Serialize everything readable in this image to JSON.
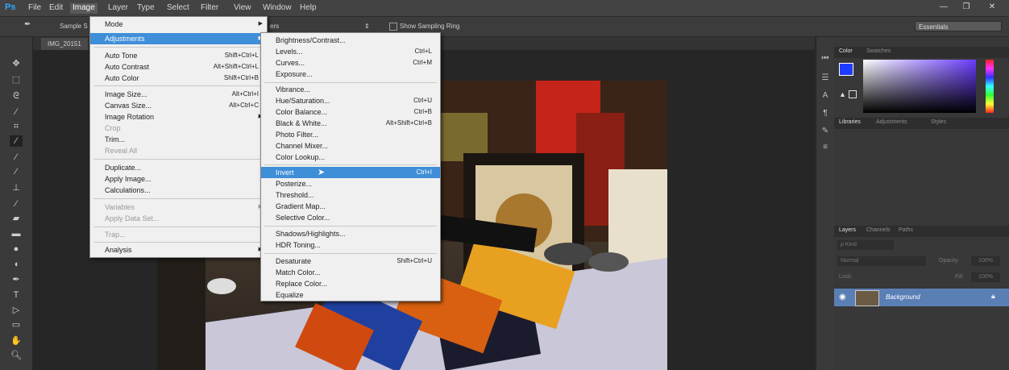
{
  "app": {
    "logo": "Ps"
  },
  "menubar": {
    "items": [
      "File",
      "Edit",
      "Image",
      "Layer",
      "Type",
      "Select",
      "Filter",
      "View",
      "Window",
      "Help"
    ]
  },
  "window_controls": {
    "minimize": "—",
    "maximize": "❐",
    "close": "✕"
  },
  "options_bar": {
    "sample_label": "Sample S",
    "layers_label": "ers",
    "show_ring_label": "Show Sampling Ring",
    "workspace": "Essentials"
  },
  "document": {
    "tab_title": "IMG_20151"
  },
  "image_menu": {
    "items": [
      {
        "label": "Mode",
        "shortcut": "",
        "submenu": true,
        "disabled": false
      },
      {
        "label": "Adjustments",
        "shortcut": "",
        "submenu": true,
        "disabled": false
      },
      {
        "label": "Auto Tone",
        "shortcut": "Shift+Ctrl+L",
        "submenu": false,
        "disabled": false
      },
      {
        "label": "Auto Contrast",
        "shortcut": "Alt+Shift+Ctrl+L",
        "submenu": false,
        "disabled": false
      },
      {
        "label": "Auto Color",
        "shortcut": "Shift+Ctrl+B",
        "submenu": false,
        "disabled": false
      },
      {
        "label": "Image Size...",
        "shortcut": "Alt+Ctrl+I",
        "submenu": false,
        "disabled": false
      },
      {
        "label": "Canvas Size...",
        "shortcut": "Alt+Ctrl+C",
        "submenu": false,
        "disabled": false
      },
      {
        "label": "Image Rotation",
        "shortcut": "",
        "submenu": true,
        "disabled": false
      },
      {
        "label": "Crop",
        "shortcut": "",
        "submenu": false,
        "disabled": true
      },
      {
        "label": "Trim...",
        "shortcut": "",
        "submenu": false,
        "disabled": false
      },
      {
        "label": "Reveal All",
        "shortcut": "",
        "submenu": false,
        "disabled": true
      },
      {
        "label": "Duplicate...",
        "shortcut": "",
        "submenu": false,
        "disabled": false
      },
      {
        "label": "Apply Image...",
        "shortcut": "",
        "submenu": false,
        "disabled": false
      },
      {
        "label": "Calculations...",
        "shortcut": "",
        "submenu": false,
        "disabled": false
      },
      {
        "label": "Variables",
        "shortcut": "",
        "submenu": true,
        "disabled": true
      },
      {
        "label": "Apply Data Set...",
        "shortcut": "",
        "submenu": false,
        "disabled": true
      },
      {
        "label": "Trap...",
        "shortcut": "",
        "submenu": false,
        "disabled": true
      },
      {
        "label": "Analysis",
        "shortcut": "",
        "submenu": true,
        "disabled": false
      }
    ]
  },
  "adjustments_menu": {
    "items": [
      {
        "label": "Brightness/Contrast...",
        "shortcut": ""
      },
      {
        "label": "Levels...",
        "shortcut": "Ctrl+L"
      },
      {
        "label": "Curves...",
        "shortcut": "Ctrl+M"
      },
      {
        "label": "Exposure...",
        "shortcut": ""
      },
      {
        "label": "Vibrance...",
        "shortcut": ""
      },
      {
        "label": "Hue/Saturation...",
        "shortcut": "Ctrl+U"
      },
      {
        "label": "Color Balance...",
        "shortcut": "Ctrl+B"
      },
      {
        "label": "Black & White...",
        "shortcut": "Alt+Shift+Ctrl+B"
      },
      {
        "label": "Photo Filter...",
        "shortcut": ""
      },
      {
        "label": "Channel Mixer...",
        "shortcut": ""
      },
      {
        "label": "Color Lookup...",
        "shortcut": ""
      },
      {
        "label": "Invert",
        "shortcut": "Ctrl+I"
      },
      {
        "label": "Posterize...",
        "shortcut": ""
      },
      {
        "label": "Threshold...",
        "shortcut": ""
      },
      {
        "label": "Gradient Map...",
        "shortcut": ""
      },
      {
        "label": "Selective Color...",
        "shortcut": ""
      },
      {
        "label": "Shadows/Highlights...",
        "shortcut": ""
      },
      {
        "label": "HDR Toning...",
        "shortcut": ""
      },
      {
        "label": "Desaturate",
        "shortcut": "Shift+Ctrl+U"
      },
      {
        "label": "Match Color...",
        "shortcut": ""
      },
      {
        "label": "Replace Color...",
        "shortcut": ""
      },
      {
        "label": "Equalize",
        "shortcut": ""
      }
    ]
  },
  "panels": {
    "color_tabs": [
      "Color",
      "Swatches"
    ],
    "lib_tabs": [
      "Libraries",
      "Adjustments",
      "Styles"
    ],
    "layer_tabs": [
      "Layers",
      "Channels",
      "Paths"
    ],
    "kind_label": "ρ Kind",
    "blend_mode": "Normal",
    "opacity_label": "Opacity:",
    "opacity_value": "100%",
    "lock_label": "Lock:",
    "fill_label": "Fill:",
    "fill_value": "100%",
    "layer_name": "Background"
  },
  "colors": {
    "highlight": "#3f8ed8",
    "foreground": "#1e3cff",
    "panel_bg": "#383838"
  }
}
